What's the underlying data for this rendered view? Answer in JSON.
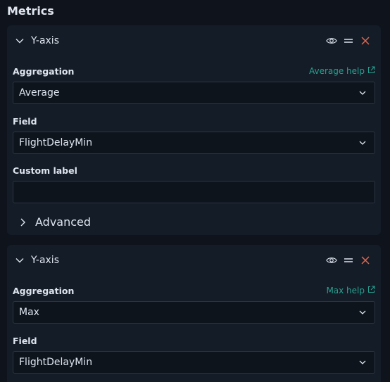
{
  "section": {
    "title": "Metrics"
  },
  "panels": [
    {
      "title": "Y-axis",
      "aggregation": {
        "label": "Aggregation",
        "value": "Average",
        "help": "Average help"
      },
      "field": {
        "label": "Field",
        "value": "FlightDelayMin"
      },
      "custom_label": {
        "label": "Custom label",
        "value": ""
      },
      "advanced": {
        "label": "Advanced"
      }
    },
    {
      "title": "Y-axis",
      "aggregation": {
        "label": "Aggregation",
        "value": "Max",
        "help": "Max help"
      },
      "field": {
        "label": "Field",
        "value": "FlightDelayMin"
      }
    }
  ],
  "icons": {
    "toggle": "chevron-down-icon",
    "visibility": "eye-icon",
    "drag": "drag-handle-icon",
    "remove": "close-icon",
    "external": "external-link-icon",
    "select_caret": "chevron-down-icon",
    "advanced_toggle": "chevron-right-icon"
  },
  "colors": {
    "background": "#0f131b",
    "panel": "#141c27",
    "input": "#0e141c",
    "border": "#2b3544",
    "text": "#dfe5ef",
    "link": "#28a08f",
    "danger": "#e7664c"
  }
}
